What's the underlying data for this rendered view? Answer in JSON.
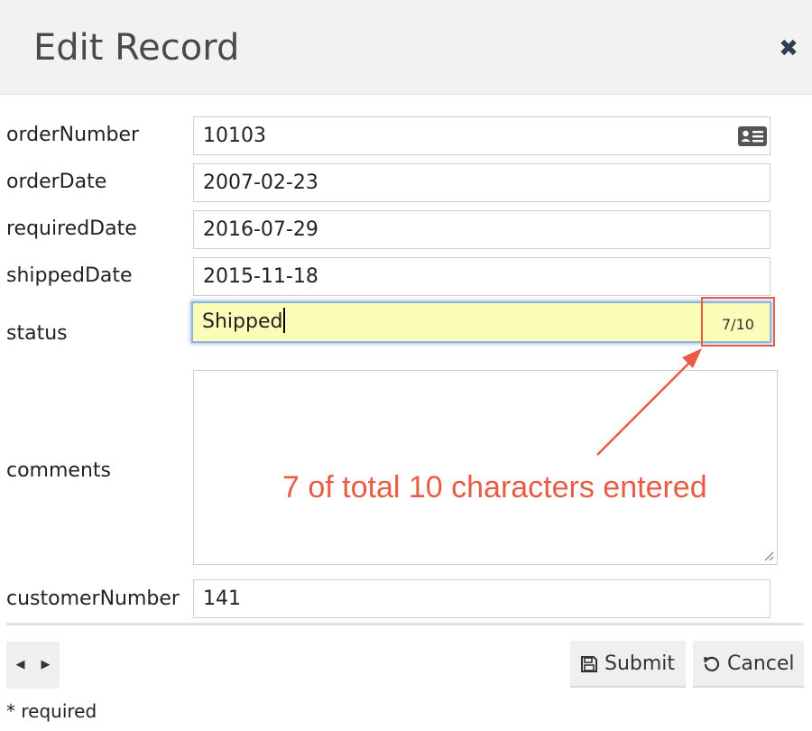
{
  "dialog": {
    "title": "Edit Record",
    "close_icon": "close-icon"
  },
  "form": {
    "fields": [
      {
        "key": "orderNumber",
        "label": "orderNumber",
        "value": "10103"
      },
      {
        "key": "orderDate",
        "label": "orderDate",
        "value": "2007-02-23"
      },
      {
        "key": "requiredDate",
        "label": "requiredDate",
        "value": "2016-07-29"
      },
      {
        "key": "shippedDate",
        "label": "shippedDate",
        "value": "2015-11-18"
      },
      {
        "key": "status",
        "label": "status",
        "value": "Shipped",
        "counter": "7/10"
      },
      {
        "key": "comments",
        "label": "comments",
        "value": ""
      },
      {
        "key": "customerNumber",
        "label": "customerNumber",
        "value": "141"
      }
    ]
  },
  "annotation": {
    "text": "7 of total 10 characters entered",
    "color": "#e85c46"
  },
  "footer": {
    "prev_icon": "caret-left-icon",
    "next_icon": "caret-right-icon",
    "submit_label": "Submit",
    "cancel_label": "Cancel",
    "required_note": "* required"
  },
  "colors": {
    "header_bg": "#f2f2f2",
    "focus_bg": "#fafcb8",
    "focus_border": "#8fb4dd",
    "close_icon": "#2f3e53"
  }
}
